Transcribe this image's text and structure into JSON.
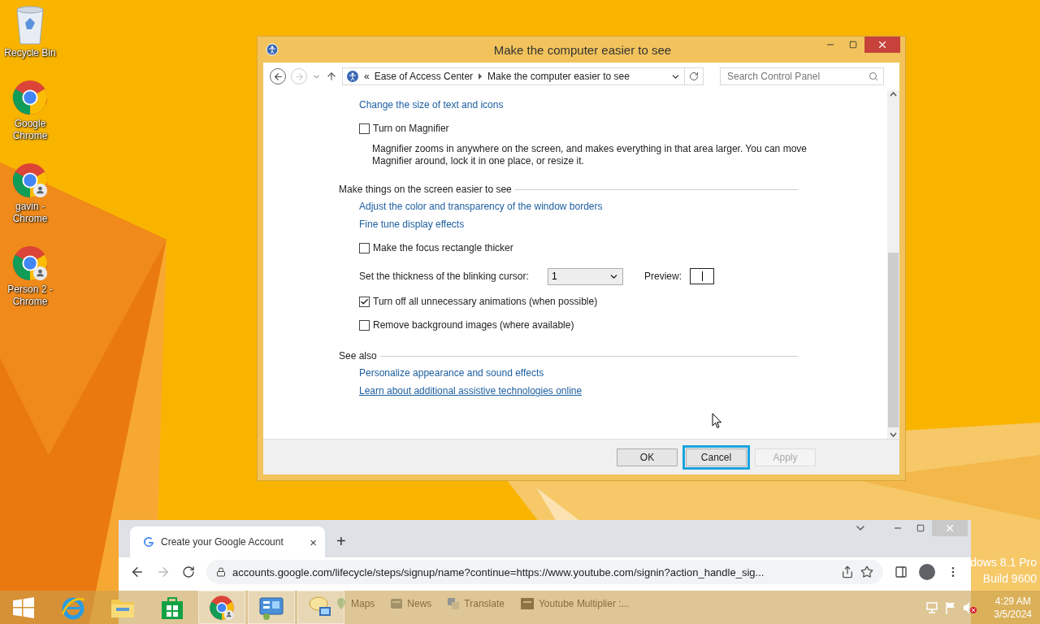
{
  "desktop": {
    "icons": [
      {
        "label": "Recycle Bin",
        "kind": "recycle"
      },
      {
        "label": "Google Chrome",
        "kind": "chrome"
      },
      {
        "label": "gavin - Chrome",
        "kind": "chrome-profile"
      },
      {
        "label": "Person 2 - Chrome",
        "kind": "chrome-profile"
      }
    ],
    "edition": [
      "dows 8.1 Pro",
      "Build 9600"
    ]
  },
  "dialog": {
    "title": "Make the computer easier to see",
    "nav": {
      "forward_disabled": true
    },
    "breadcrumb": {
      "prefix": "«",
      "items": [
        "Ease of Access Center",
        "Make the computer easier to see"
      ]
    },
    "search": {
      "placeholder": "Search Control Panel"
    },
    "content": [
      {
        "kind": "link",
        "text": "Change the size of text and icons",
        "hovered": false
      },
      {
        "kind": "checkbox",
        "label": "Turn on Magnifier",
        "checked": false
      },
      {
        "kind": "description",
        "text": "Magnifier zooms in anywhere on the screen, and makes everything in that area larger. You can move Magnifier around, lock it in one place, or resize it."
      },
      {
        "kind": "heading",
        "text": "Make things on the screen easier to see"
      },
      {
        "kind": "link",
        "text": "Adjust the color and transparency of the window borders",
        "hovered": false
      },
      {
        "kind": "link",
        "text": "Fine tune display effects",
        "hovered": false
      },
      {
        "kind": "checkbox",
        "label": "Make the focus rectangle thicker",
        "checked": false
      },
      {
        "kind": "select",
        "label": "Set the thickness of the blinking cursor:",
        "value": "1",
        "preview_label": "Preview:"
      },
      {
        "kind": "checkbox",
        "label": "Turn off all unnecessary animations (when possible)",
        "checked": true
      },
      {
        "kind": "checkbox",
        "label": "Remove background images (where available)",
        "checked": false
      },
      {
        "kind": "heading",
        "text": "See also"
      },
      {
        "kind": "link",
        "text": "Personalize appearance and sound effects",
        "hovered": false
      },
      {
        "kind": "link",
        "text": "Learn about additional assistive technologies online",
        "hovered": true
      }
    ],
    "buttons": [
      {
        "label": "OK",
        "focused": false,
        "disabled": false
      },
      {
        "label": "Cancel",
        "focused": true,
        "disabled": false
      },
      {
        "label": "Apply",
        "focused": false,
        "disabled": true
      }
    ]
  },
  "browser": {
    "tab": {
      "title": "Create your Google Account",
      "close": "×"
    },
    "new_tab": "+",
    "url": "accounts.google.com/lifecycle/steps/signup/name?continue=https://www.youtube.com/signin?action_handle_sig...",
    "bookmarks": [
      {
        "label": "Maps",
        "kind": "maps"
      },
      {
        "label": "News",
        "kind": "news"
      },
      {
        "label": "Translate",
        "kind": "translate"
      },
      {
        "label": "Youtube Multiplier :...",
        "kind": "app"
      }
    ]
  },
  "taskbar": {
    "apps": [
      {
        "kind": "ie",
        "selected": false
      },
      {
        "kind": "explorer",
        "selected": false
      },
      {
        "kind": "store",
        "selected": false
      },
      {
        "kind": "chrome",
        "selected": true
      },
      {
        "kind": "control-panel",
        "selected": true
      },
      {
        "kind": "remote",
        "selected": true
      }
    ],
    "clock": {
      "time": "4:29 AM",
      "date": "3/5/2024"
    }
  }
}
